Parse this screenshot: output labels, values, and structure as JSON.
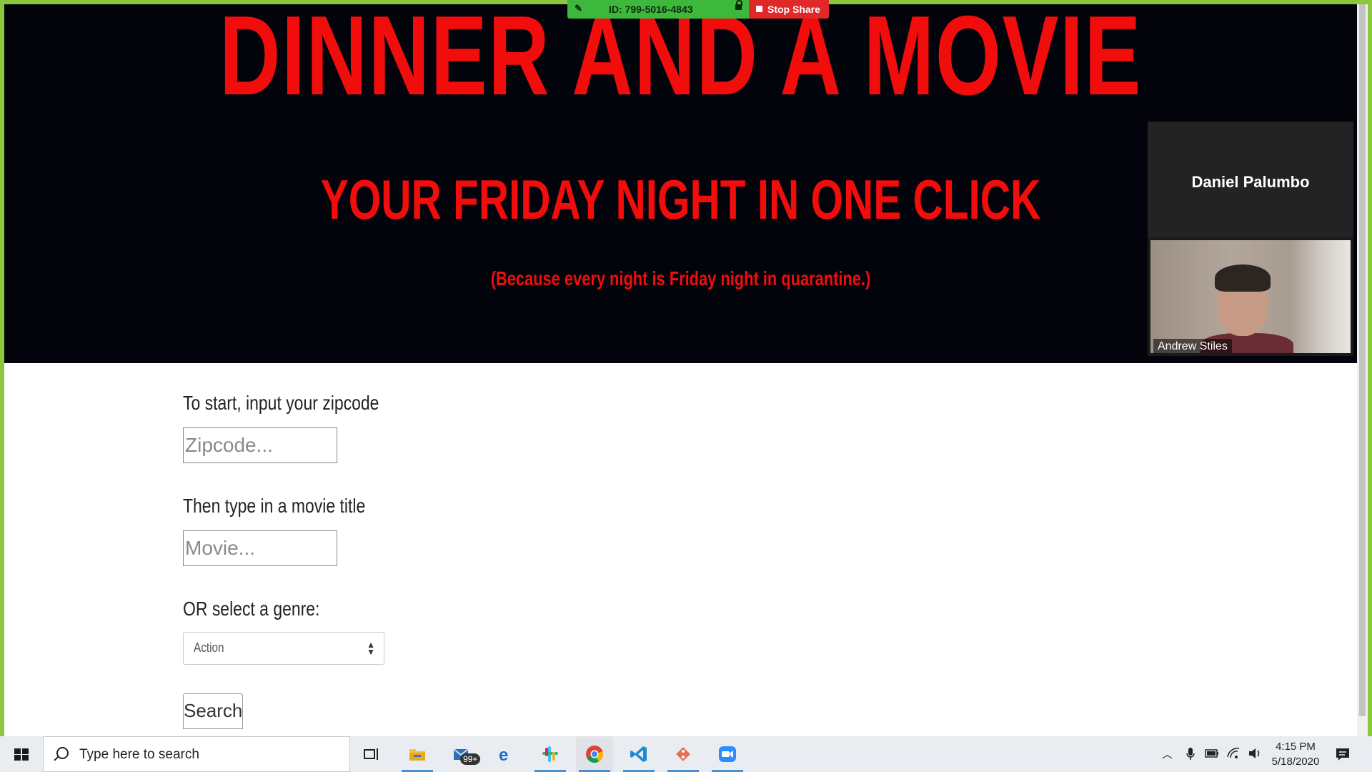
{
  "zoom": {
    "meeting_id": "ID: 799-5016-4843",
    "stop_share_label": "Stop Share",
    "speaker_name": "Daniel Palumbo",
    "video_label": "Andrew Stiles",
    "border_color": "#8cc63f"
  },
  "hero": {
    "title": "DINNER AND A MOVIE",
    "subtitle": "YOUR FRIDAY NIGHT IN ONE CLICK",
    "note": "(Because every night is Friday night in quarantine.)",
    "accent_color": "#f20d0d",
    "background": "#03030b"
  },
  "form": {
    "zip_label": "To start, input your zipcode",
    "zip_placeholder": "Zipcode...",
    "movie_label": "Then type in a movie title",
    "movie_placeholder": "Movie...",
    "genre_label": "OR select a genre:",
    "genre_selected": "Action",
    "search_label": "Search"
  },
  "taskbar": {
    "search_placeholder": "Type here to search",
    "mail_badge": "99+",
    "time": "4:15 PM",
    "date": "5/18/2020",
    "apps": [
      "file-explorer",
      "mail",
      "edge",
      "slack",
      "chrome",
      "vscode",
      "git",
      "zoom"
    ]
  }
}
